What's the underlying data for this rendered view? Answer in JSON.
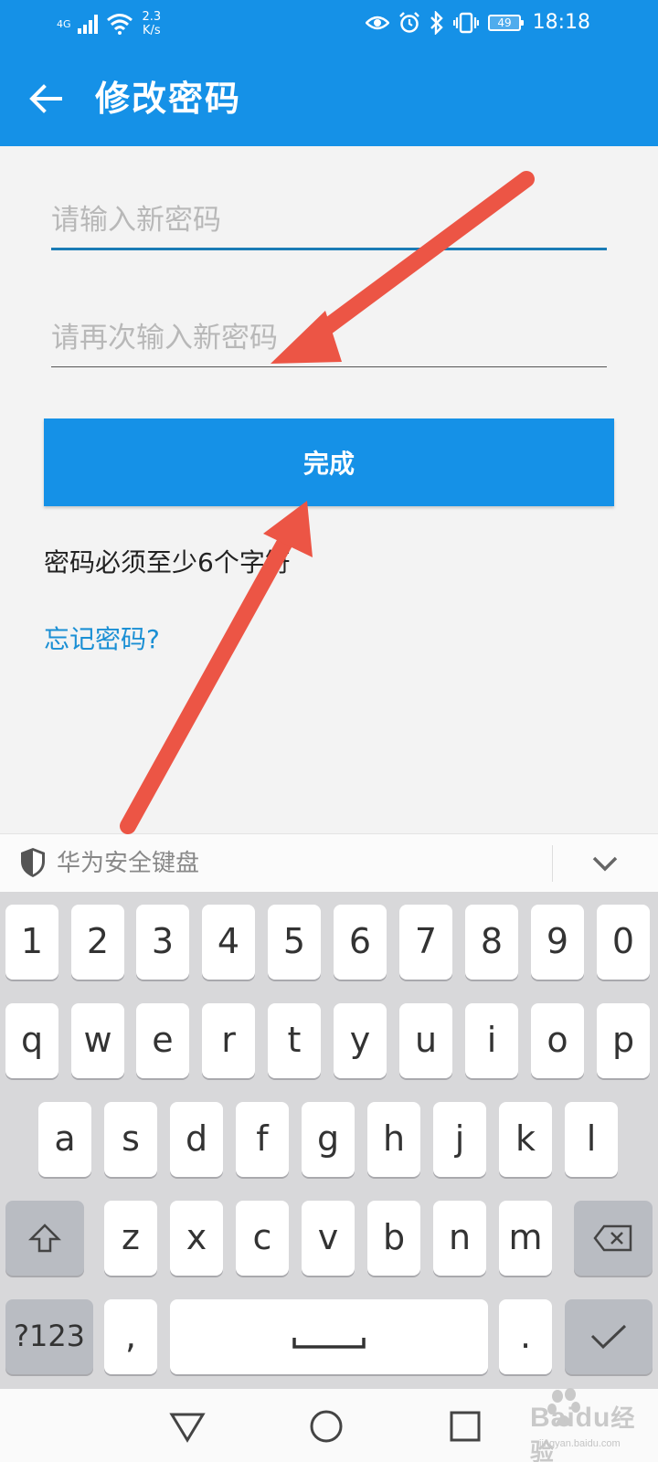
{
  "status_bar": {
    "network": "4G",
    "speed_top": "2.3",
    "speed_bottom": "K/s",
    "battery": "49",
    "time": "18:18"
  },
  "header": {
    "title": "修改密码"
  },
  "form": {
    "new_password_placeholder": "请输入新密码",
    "confirm_password_placeholder": "请再次输入新密码",
    "done_label": "完成",
    "hint": "密码必须至少6个字符",
    "forgot_label": "忘记密码?"
  },
  "keyboard": {
    "title": "华为安全键盘",
    "row_numbers": [
      "1",
      "2",
      "3",
      "4",
      "5",
      "6",
      "7",
      "8",
      "9",
      "0"
    ],
    "row_top": [
      "q",
      "w",
      "e",
      "r",
      "t",
      "y",
      "u",
      "i",
      "o",
      "p"
    ],
    "row_middle": [
      "a",
      "s",
      "d",
      "f",
      "g",
      "h",
      "j",
      "k",
      "l"
    ],
    "row_bottom": [
      "z",
      "x",
      "c",
      "v",
      "b",
      "n",
      "m"
    ],
    "symbols_label": "?123",
    "comma": ",",
    "period": "."
  },
  "watermark": {
    "brand": "Baidu",
    "suffix": "经验",
    "url": "jingyan.baidu.com"
  },
  "colors": {
    "primary": "#1591e7",
    "link": "#1a8fd4",
    "annotation_arrow": "#ec5545"
  }
}
